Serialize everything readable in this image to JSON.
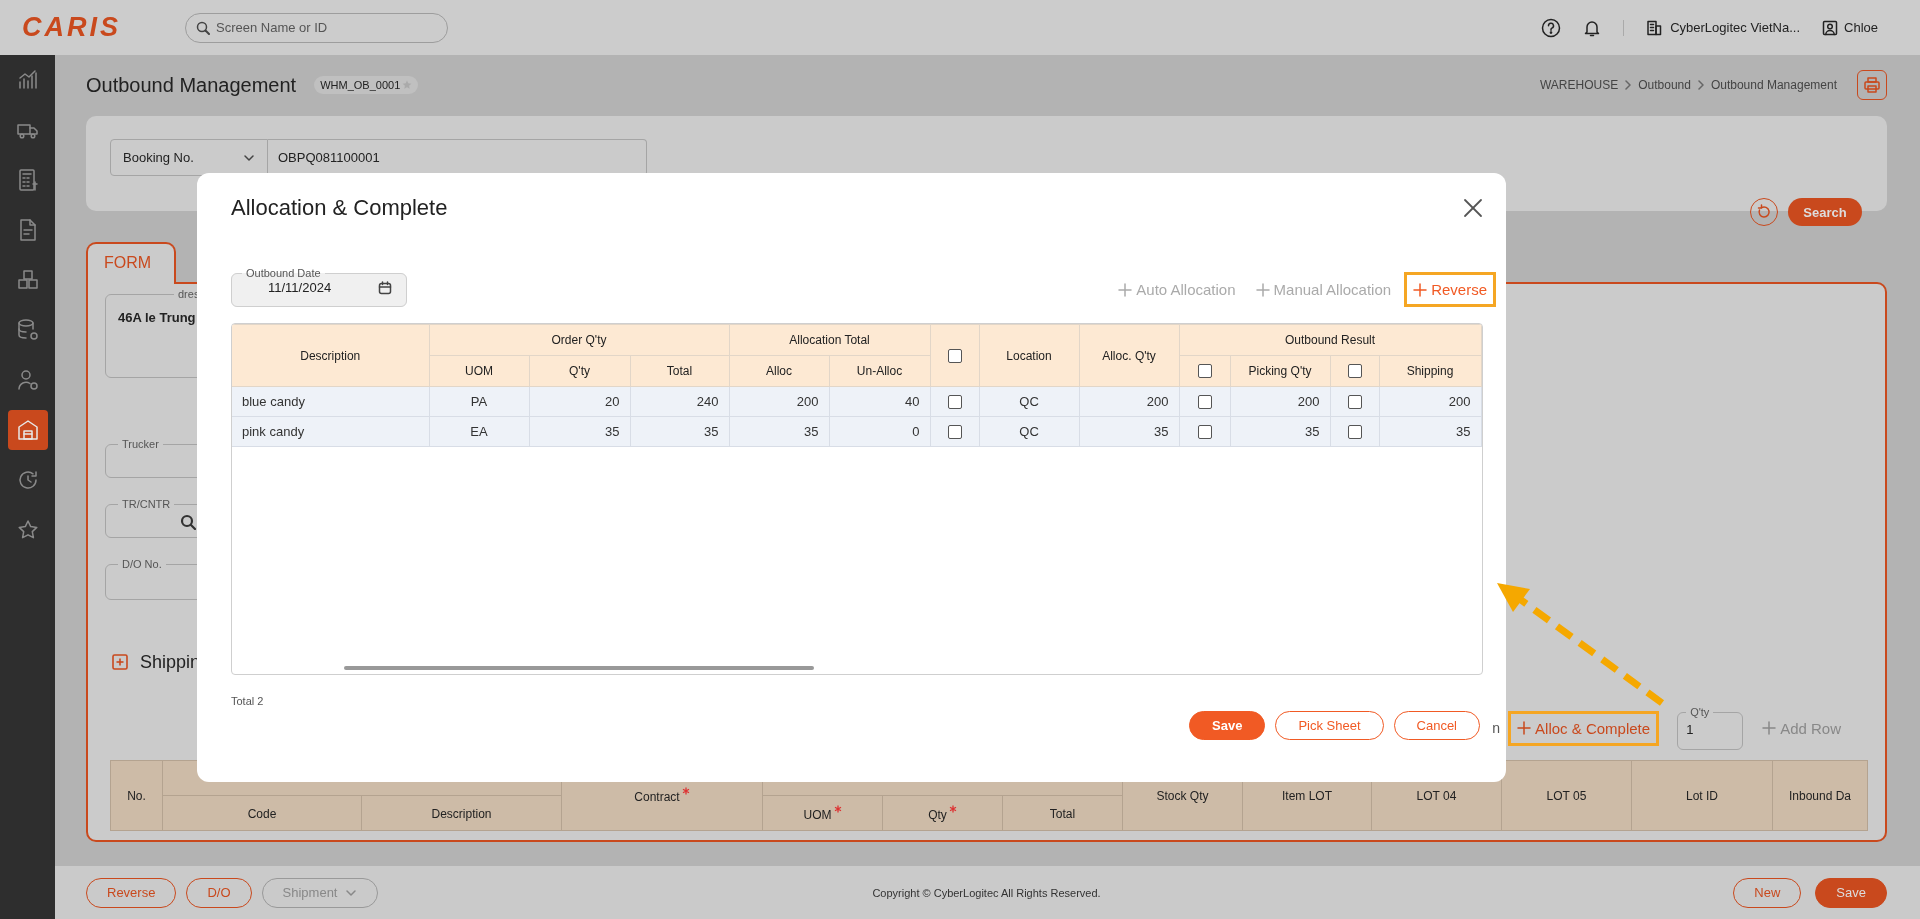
{
  "header": {
    "logo": "CARIS",
    "search": {
      "placeholder": "Screen Name or ID"
    },
    "company": "CyberLogitec VietNa...",
    "user": "Chloe"
  },
  "sidebar": {
    "items": [
      {
        "selected": false
      },
      {
        "selected": false
      },
      {
        "selected": false
      },
      {
        "selected": false
      },
      {
        "selected": false
      },
      {
        "selected": false
      },
      {
        "selected": false
      },
      {
        "selected": true
      },
      {
        "selected": false
      },
      {
        "selected": false
      }
    ]
  },
  "page": {
    "title": "Outbound Management",
    "screen_id": "WHM_OB_0001",
    "breadcrumb": [
      "WAREHOUSE",
      "Outbound",
      "Outbound Management"
    ]
  },
  "search_panel": {
    "field": "Booking No.",
    "value": "OBPQ081100001",
    "search_button": "Search"
  },
  "form": {
    "tab": {
      "label": "FORM",
      "selected": true
    },
    "address": {
      "label": "dres",
      "value": "46A le Trung"
    },
    "fields": [
      {
        "label": "Trucker",
        "kind": "text"
      },
      {
        "label": "TR/CNTR",
        "kind": "lookup"
      },
      {
        "label": "D/O No.",
        "kind": "text"
      }
    ],
    "section_title": "Shippin",
    "toolbar": [
      {
        "kind": "text",
        "label": "n"
      },
      {
        "kind": "action",
        "label": "Alloc & Complete",
        "enabled": true,
        "highlighted": true
      },
      {
        "kind": "qty",
        "label": "Q'ty",
        "value": "1"
      },
      {
        "kind": "action",
        "label": "Add Row",
        "enabled": false,
        "highlighted": false
      }
    ],
    "grid": {
      "header": [
        {
          "label": "No."
        },
        {
          "columns": [
            {
              "label": "Code",
              "required": false
            },
            {
              "label": "Description",
              "required": false
            }
          ]
        },
        {
          "label": "Contract",
          "required": true
        },
        {
          "columns": [
            {
              "label": "UOM",
              "required": true
            },
            {
              "label": "Qty",
              "required": true
            },
            {
              "label": "Total",
              "required": false
            }
          ]
        },
        {
          "label": "Stock Qty"
        },
        {
          "label": "Item LOT"
        },
        {
          "label": "LOT 04"
        },
        {
          "label": "LOT 05"
        },
        {
          "label": "Lot ID"
        },
        {
          "label": "Inbound Da"
        }
      ]
    }
  },
  "modal": {
    "title": "Allocation & Complete",
    "outbound_date": {
      "label": "Outbound Date",
      "value": "11/11/2024"
    },
    "actions": [
      {
        "label": "Auto Allocation",
        "enabled": false,
        "highlighted": false
      },
      {
        "label": "Manual Allocation",
        "enabled": false,
        "highlighted": false
      },
      {
        "label": "Reverse",
        "enabled": true,
        "highlighted": true
      }
    ],
    "table": {
      "header": [
        {
          "label": "Description",
          "kind": "text"
        },
        {
          "label": "Order Q'ty",
          "columns": [
            {
              "label": "UOM",
              "kind": "code"
            },
            {
              "label": "Q'ty",
              "kind": "number"
            },
            {
              "label": "Total",
              "kind": "number"
            }
          ]
        },
        {
          "label": "Allocation Total",
          "columns": [
            {
              "label": "Alloc",
              "kind": "number"
            },
            {
              "label": "Un-Alloc",
              "kind": "number"
            }
          ]
        },
        {
          "kind": "check",
          "checked": false
        },
        {
          "label": "Location",
          "kind": "code"
        },
        {
          "label": "Alloc. Q'ty",
          "kind": "number"
        },
        {
          "label": "Outbound Result",
          "columns": [
            {
              "kind": "check",
              "checked": false
            },
            {
              "label": "Picking Q'ty",
              "kind": "number"
            },
            {
              "kind": "check",
              "checked": false
            },
            {
              "label": "Shipping",
              "kind": "number"
            }
          ]
        }
      ],
      "rows": [
        {
          "cells": [
            {
              "text": "blue candy"
            },
            {
              "text": "PA"
            },
            {
              "text": "20"
            },
            {
              "text": "240"
            },
            {
              "text": "200"
            },
            {
              "text": "40"
            },
            {
              "checked": false
            },
            {
              "text": "QC"
            },
            {
              "text": "200"
            },
            {
              "checked": false
            },
            {
              "text": "200"
            },
            {
              "checked": false
            },
            {
              "text": "200"
            }
          ]
        },
        {
          "cells": [
            {
              "text": "pink candy"
            },
            {
              "text": "EA"
            },
            {
              "text": "35"
            },
            {
              "text": "35"
            },
            {
              "text": "35"
            },
            {
              "text": "0"
            },
            {
              "checked": false
            },
            {
              "text": "QC"
            },
            {
              "text": "35"
            },
            {
              "checked": false
            },
            {
              "text": "35"
            },
            {
              "checked": false
            },
            {
              "text": "35"
            }
          ]
        }
      ]
    },
    "total": "Total 2",
    "buttons": [
      {
        "label": "Save",
        "kind": "primary"
      },
      {
        "label": "Pick Sheet",
        "kind": "outline"
      },
      {
        "label": "Cancel",
        "kind": "outline"
      }
    ]
  },
  "bottom_bar": {
    "left": [
      {
        "label": "Reverse",
        "kind": "outline"
      },
      {
        "label": "D/O",
        "kind": "outline"
      },
      {
        "label": "Shipment",
        "kind": "dropdown",
        "disabled": true
      }
    ],
    "copyright": "Copyright © CyberLogitec All Rights Reserved.",
    "right": [
      {
        "label": "New",
        "kind": "outline"
      },
      {
        "label": "Save",
        "kind": "primary"
      }
    ]
  }
}
